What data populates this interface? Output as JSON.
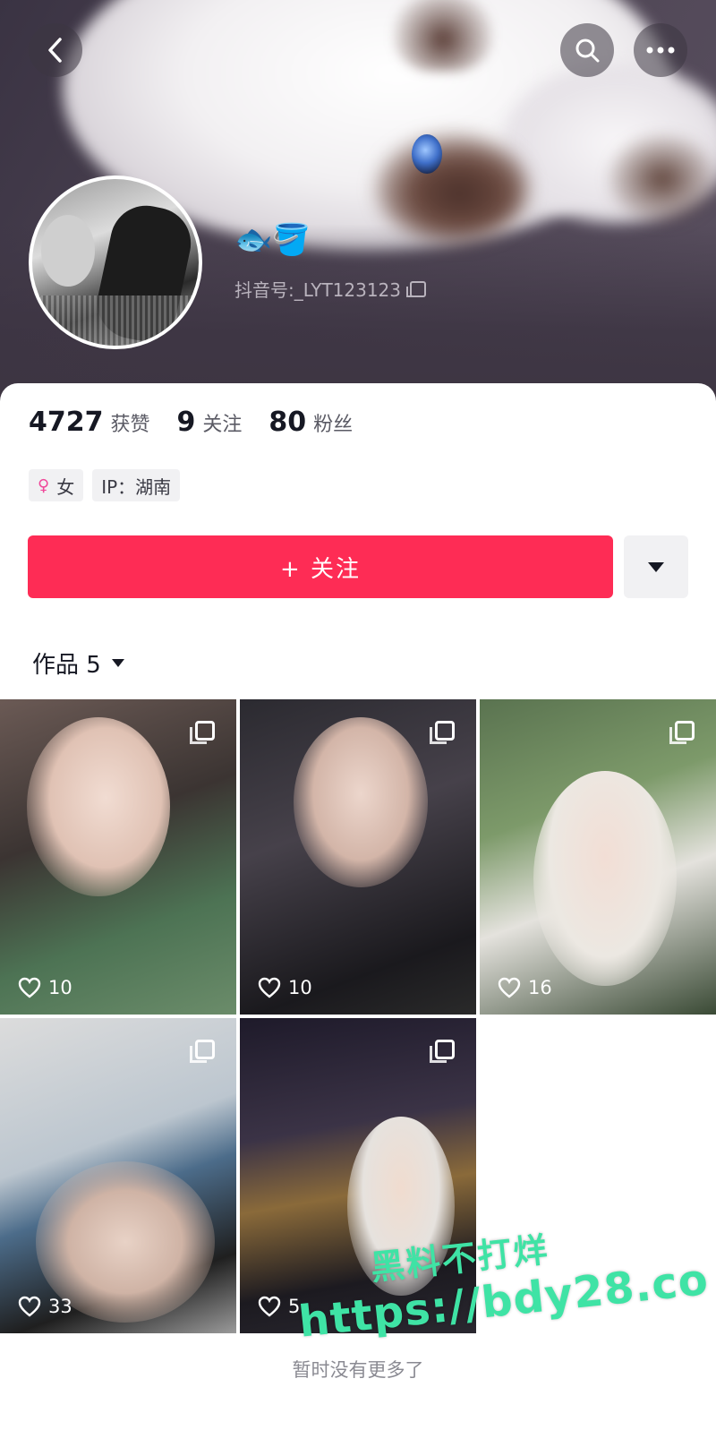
{
  "header": {
    "name_emoji": "🐟🪣",
    "douyin_id": "抖音号:_LYT123123"
  },
  "stats": {
    "likes_count": "4727",
    "likes_label": "获赞",
    "following_count": "9",
    "following_label": "关注",
    "followers_count": "80",
    "followers_label": "粉丝"
  },
  "tags": {
    "gender_icon": "♀",
    "gender": "女",
    "ip": "IP：湖南"
  },
  "actions": {
    "follow_label": "+ 关注"
  },
  "works": {
    "tab_label": "作品 5",
    "items": [
      {
        "likes": "10"
      },
      {
        "likes": "10"
      },
      {
        "likes": "16"
      },
      {
        "likes": "33"
      },
      {
        "likes": "5"
      }
    ],
    "no_more": "暂时没有更多了"
  },
  "watermark": {
    "line1": "黑料不打烊",
    "line2": "https://bdy28.co"
  },
  "colors": {
    "accent": "#fe2c55",
    "watermark": "#3fe3a5"
  }
}
